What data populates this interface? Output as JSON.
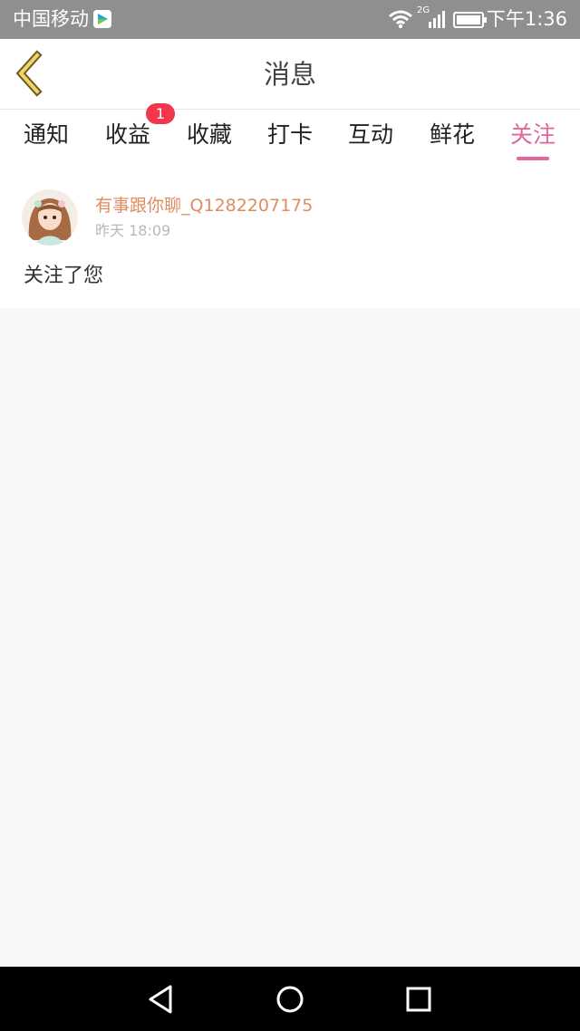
{
  "statusbar": {
    "carrier": "中国移动",
    "network": "2G",
    "time": "下午1:36"
  },
  "header": {
    "title": "消息",
    "back_icon": "chevron-left-icon"
  },
  "tabs": [
    {
      "label": "通知"
    },
    {
      "label": "收益",
      "badge": "1"
    },
    {
      "label": "收藏"
    },
    {
      "label": "打卡"
    },
    {
      "label": "互动"
    },
    {
      "label": "鲜花"
    },
    {
      "label": "关注",
      "active": true
    }
  ],
  "message": {
    "user": "有事跟你聊_Q1282207175",
    "time": "昨天 18:09",
    "text": "关注了您"
  },
  "colors": {
    "accent": "#e4649c",
    "badge": "#f2374d",
    "username": "#e08c62"
  },
  "navbar": {
    "back_icon": "triangle-back-icon",
    "home_icon": "circle-home-icon",
    "recent_icon": "square-recent-icon"
  }
}
